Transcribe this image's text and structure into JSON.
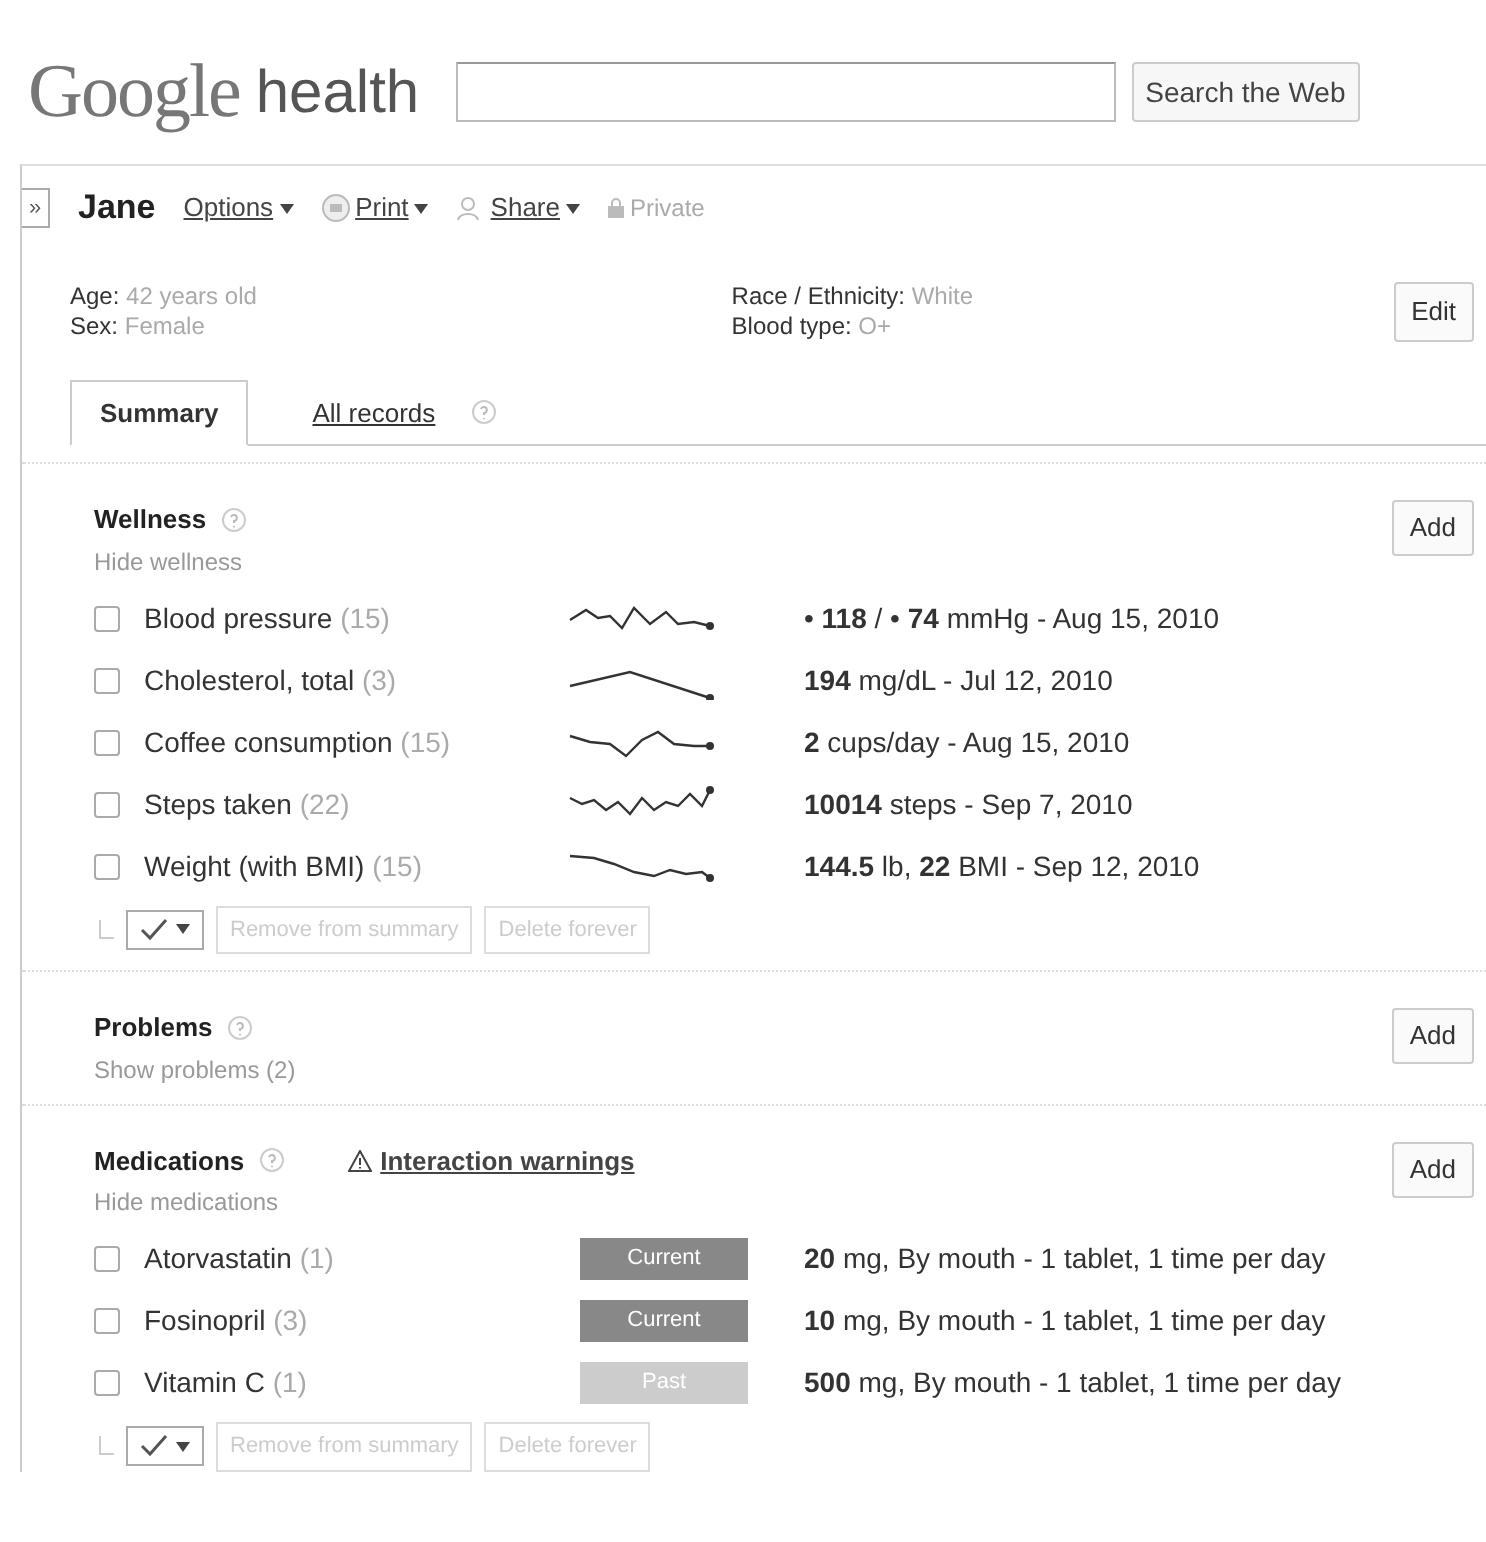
{
  "header": {
    "logo_brand": "Google",
    "logo_product": "health",
    "search_button": "Search the Web"
  },
  "profile": {
    "expand_toggle": "»",
    "name": "Jane",
    "menus": [
      {
        "label": "Options"
      },
      {
        "label": "Print"
      },
      {
        "label": "Share"
      }
    ],
    "privacy": "Private",
    "facts_left": [
      {
        "label": "Age:",
        "value": "42 years old"
      },
      {
        "label": "Sex:",
        "value": "Female"
      }
    ],
    "facts_right": [
      {
        "label": "Race / Ethnicity:",
        "value": "White"
      },
      {
        "label": "Blood type:",
        "value": "O+"
      }
    ],
    "edit_button": "Edit"
  },
  "tabs": [
    {
      "label": "Summary",
      "selected": true,
      "help": false
    },
    {
      "label": "All records",
      "selected": false,
      "help": true
    }
  ],
  "sections": [
    {
      "title": "Wellness",
      "toggle": "Hide wellness",
      "add_button": "Add",
      "kind": "wellness",
      "items": [
        {
          "name": "Blood pressure",
          "count": "(15)",
          "checked": false,
          "value": "• **118** / • **74** mmHg - Aug 15, 2010"
        },
        {
          "name": "Cholesterol, total",
          "count": "(3)",
          "checked": false,
          "value": "**194** mg/dL - Jul 12, 2010"
        },
        {
          "name": "Coffee consumption",
          "count": "(15)",
          "checked": false,
          "value": "**2** cups/day - Aug 15, 2010"
        },
        {
          "name": "Steps taken",
          "count": "(22)",
          "checked": false,
          "value": "**10014** steps - Sep 7, 2010"
        },
        {
          "name": "Weight (with BMI)",
          "count": "(15)",
          "checked": false,
          "value": "**144.5** lb, **22** BMI - Sep 12, 2010"
        }
      ],
      "actions": {
        "remove": "Remove from summary",
        "delete": "Delete forever",
        "disabled": true
      }
    },
    {
      "title": "Problems",
      "toggle": "Show problems (2)",
      "add_button": "Add",
      "kind": "collapsed"
    },
    {
      "title": "Medications",
      "warning_link": "Interaction warnings",
      "toggle": "Hide medications",
      "add_button": "Add",
      "kind": "medications",
      "items": [
        {
          "name": "Atorvastatin",
          "count": "(1)",
          "checked": false,
          "status": "Current",
          "kind": "current",
          "value": "**20** mg, By mouth - 1 tablet, 1 time per day"
        },
        {
          "name": "Fosinopril",
          "count": "(3)",
          "checked": false,
          "status": "Current",
          "kind": "current",
          "value": "**10** mg, By mouth - 1 tablet, 1 time per day"
        },
        {
          "name": "Vitamin C",
          "count": "(1)",
          "checked": false,
          "status": "Past",
          "kind": "past",
          "value": "**500** mg, By mouth - 1 tablet, 1 time per day"
        }
      ],
      "actions": {
        "remove": "Remove from summary",
        "delete": "Delete forever",
        "disabled": true
      }
    }
  ]
}
